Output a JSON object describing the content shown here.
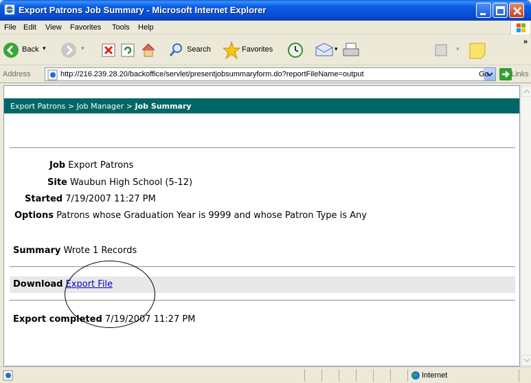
{
  "window": {
    "title": "Export Patrons Job Summary - Microsoft Internet Explorer"
  },
  "menu": [
    "File",
    "Edit",
    "View",
    "Favorites",
    "Tools",
    "Help"
  ],
  "toolbar": {
    "back_label": "Back",
    "search_label": "Search",
    "favorites_label": "Favorites"
  },
  "address": {
    "label": "Address",
    "url": "http://216.239.28.20/backoffice/servlet/presentjobsummaryform.do?reportFileName=output",
    "go_label": "Go",
    "links_label": "Links"
  },
  "breadcrumb": {
    "part1": "Export Patrons",
    "sep": ">",
    "part2": "Job Manager",
    "current": "Job Summary"
  },
  "job": {
    "job_label": "Job",
    "job_value": "Export Patrons",
    "site_label": "Site",
    "site_value": "Waubun High School (5-12)",
    "started_label": "Started",
    "started_value": "7/19/2007 11:27 PM",
    "options_label": "Options",
    "options_value": "Patrons whose Graduation Year is 9999 and whose Patron Type is Any"
  },
  "summary": {
    "label": "Summary",
    "value": "Wrote 1 Records"
  },
  "download": {
    "label": "Download",
    "link_text": "Export File"
  },
  "completed": {
    "label": "Export completed",
    "value": "7/19/2007 11:27 PM"
  },
  "status": {
    "zone": "Internet"
  }
}
